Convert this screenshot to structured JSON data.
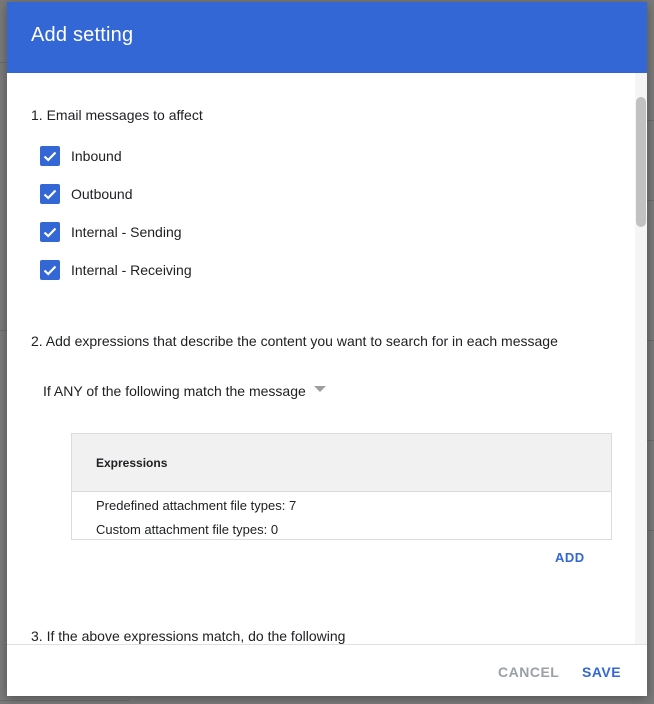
{
  "dialog": {
    "title": "Add setting",
    "cancel_label": "CANCEL",
    "save_label": "SAVE"
  },
  "section1": {
    "title": "1. Email messages to affect",
    "checkboxes": [
      {
        "label": "Inbound",
        "checked": true
      },
      {
        "label": "Outbound",
        "checked": true
      },
      {
        "label": "Internal - Sending",
        "checked": true
      },
      {
        "label": "Internal - Receiving",
        "checked": true
      }
    ]
  },
  "section2": {
    "title": "2. Add expressions that describe the content you want to search for in each message",
    "match_mode": "If ANY of the following match the message",
    "expressions_header": "Expressions",
    "expressions": [
      "Predefined attachment file types: 7",
      "Custom attachment file types: 0"
    ],
    "add_label": "ADD"
  },
  "section3": {
    "title": "3. If the above expressions match, do the following"
  },
  "icons": {
    "checkbox": "check-icon",
    "dropdown": "dropdown-arrow-icon"
  },
  "colors": {
    "accent": "#3367d6",
    "header_bg": "#3367d6",
    "cancel_text": "#9aa0a6",
    "table_header_bg": "#f1f1f1"
  }
}
